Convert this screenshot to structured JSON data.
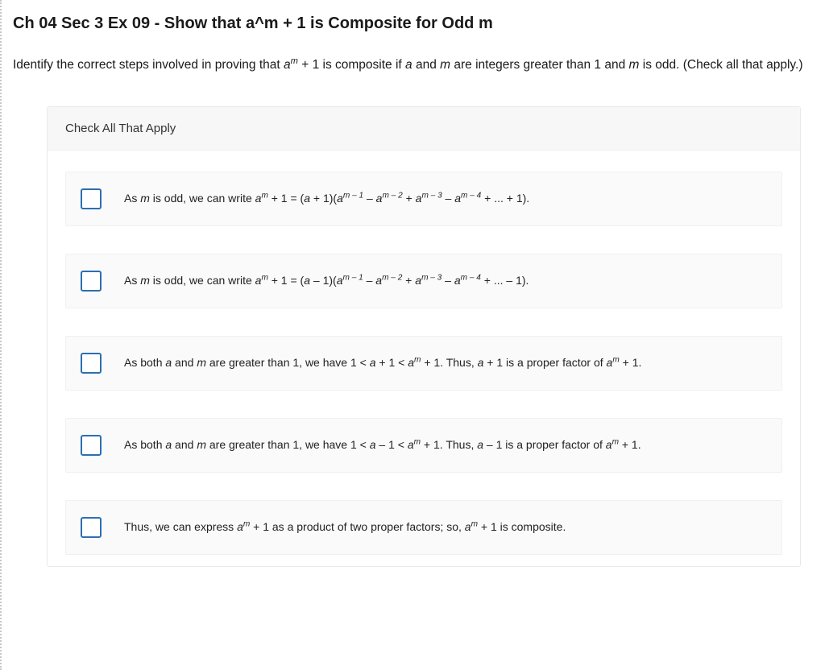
{
  "title": "Ch 04 Sec 3 Ex 09 - Show that a^m + 1 is Composite for Odd m",
  "prompt": {
    "pre1": "Identify the correct steps involved in proving that ",
    "a": "a",
    "m_sup": "m",
    "plus1": " + 1 is composite if ",
    "a2": "a",
    "and_txt": " and ",
    "m2": "m",
    "mid": " are integers greater than 1 and ",
    "m3": "m",
    "post": " is odd. (Check all that apply.)"
  },
  "panel_header": "Check All That Apply",
  "options": [
    {
      "lead": "As ",
      "mvar": "m",
      "mid": " is odd, we can write ",
      "eq_lhs_a": "a",
      "eq_lhs_sup": "m",
      "eq_lhs_tail": " + 1 = (",
      "a_var": "a",
      "plus_sign": " + 1)(",
      "t1_a": "a",
      "t1_sup": "m",
      "t1_sup2": " – 1",
      "sep1": " – ",
      "t2_a": "a",
      "t2_sup": "m",
      "t2_sup2": " – 2",
      "sep2": " + ",
      "t3_a": "a",
      "t3_sup": "m",
      "t3_sup2": " – 3",
      "sep3": " – ",
      "t4_a": "a",
      "t4_sup": "m",
      "t4_sup2": " – 4",
      "tail": " + ... + 1)."
    },
    {
      "lead": "As ",
      "mvar": "m",
      "mid": " is odd, we can write ",
      "eq_lhs_a": "a",
      "eq_lhs_sup": "m",
      "eq_lhs_tail": " + 1 = (",
      "a_var": "a",
      "plus_sign": " – 1)(",
      "t1_a": "a",
      "t1_sup": "m",
      "t1_sup2": " – 1",
      "sep1": " – ",
      "t2_a": "a",
      "t2_sup": "m",
      "t2_sup2": " – 2",
      "sep2": " + ",
      "t3_a": "a",
      "t3_sup": "m",
      "t3_sup2": " – 3",
      "sep3": " – ",
      "t4_a": "a",
      "t4_sup": "m",
      "t4_sup2": " – 4",
      "tail": " + ... – 1)."
    },
    {
      "lead": "As both ",
      "a1": "a",
      "and_txt": " and ",
      "m1": "m",
      "mid": " are greater than 1, we have 1 < ",
      "a2": "a",
      "cmp": " + 1 < ",
      "a3": "a",
      "sup3": "m",
      "post_cmp": " + 1. Thus, ",
      "a4": "a",
      "factor": " + 1 is a proper factor of ",
      "a5": "a",
      "sup5": "m",
      "end": " + 1."
    },
    {
      "lead": "As both ",
      "a1": "a",
      "and_txt": " and ",
      "m1": "m",
      "mid": " are greater than 1, we have 1 < ",
      "a2": "a",
      "cmp": " – 1 < ",
      "a3": "a",
      "sup3": "m",
      "post_cmp": " + 1. Thus, ",
      "a4": "a",
      "factor": " – 1 is a proper factor of ",
      "a5": "a",
      "sup5": "m",
      "end": " + 1."
    },
    {
      "lead": "Thus, we can express ",
      "a1": "a",
      "sup1": "m",
      "mid": " + 1 as a product of two proper factors; so, ",
      "a2": "a",
      "sup2": "m",
      "end": " + 1 is composite."
    }
  ]
}
